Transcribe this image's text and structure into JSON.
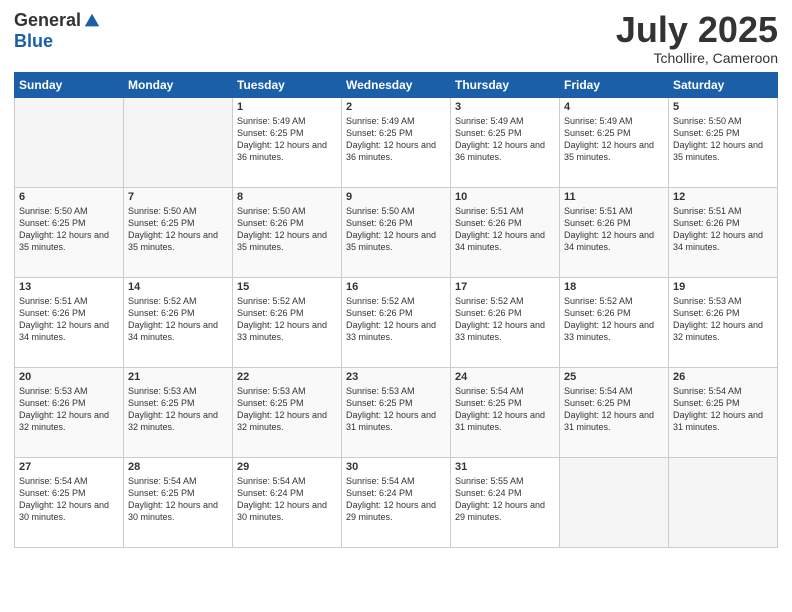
{
  "logo": {
    "general": "General",
    "blue": "Blue"
  },
  "title": {
    "month_year": "July 2025",
    "location": "Tchollire, Cameroon"
  },
  "weekdays": [
    "Sunday",
    "Monday",
    "Tuesday",
    "Wednesday",
    "Thursday",
    "Friday",
    "Saturday"
  ],
  "weeks": [
    [
      {
        "day": "",
        "sunrise": "",
        "sunset": "",
        "daylight": ""
      },
      {
        "day": "",
        "sunrise": "",
        "sunset": "",
        "daylight": ""
      },
      {
        "day": "1",
        "sunrise": "Sunrise: 5:49 AM",
        "sunset": "Sunset: 6:25 PM",
        "daylight": "Daylight: 12 hours and 36 minutes."
      },
      {
        "day": "2",
        "sunrise": "Sunrise: 5:49 AM",
        "sunset": "Sunset: 6:25 PM",
        "daylight": "Daylight: 12 hours and 36 minutes."
      },
      {
        "day": "3",
        "sunrise": "Sunrise: 5:49 AM",
        "sunset": "Sunset: 6:25 PM",
        "daylight": "Daylight: 12 hours and 36 minutes."
      },
      {
        "day": "4",
        "sunrise": "Sunrise: 5:49 AM",
        "sunset": "Sunset: 6:25 PM",
        "daylight": "Daylight: 12 hours and 35 minutes."
      },
      {
        "day": "5",
        "sunrise": "Sunrise: 5:50 AM",
        "sunset": "Sunset: 6:25 PM",
        "daylight": "Daylight: 12 hours and 35 minutes."
      }
    ],
    [
      {
        "day": "6",
        "sunrise": "Sunrise: 5:50 AM",
        "sunset": "Sunset: 6:25 PM",
        "daylight": "Daylight: 12 hours and 35 minutes."
      },
      {
        "day": "7",
        "sunrise": "Sunrise: 5:50 AM",
        "sunset": "Sunset: 6:25 PM",
        "daylight": "Daylight: 12 hours and 35 minutes."
      },
      {
        "day": "8",
        "sunrise": "Sunrise: 5:50 AM",
        "sunset": "Sunset: 6:26 PM",
        "daylight": "Daylight: 12 hours and 35 minutes."
      },
      {
        "day": "9",
        "sunrise": "Sunrise: 5:50 AM",
        "sunset": "Sunset: 6:26 PM",
        "daylight": "Daylight: 12 hours and 35 minutes."
      },
      {
        "day": "10",
        "sunrise": "Sunrise: 5:51 AM",
        "sunset": "Sunset: 6:26 PM",
        "daylight": "Daylight: 12 hours and 34 minutes."
      },
      {
        "day": "11",
        "sunrise": "Sunrise: 5:51 AM",
        "sunset": "Sunset: 6:26 PM",
        "daylight": "Daylight: 12 hours and 34 minutes."
      },
      {
        "day": "12",
        "sunrise": "Sunrise: 5:51 AM",
        "sunset": "Sunset: 6:26 PM",
        "daylight": "Daylight: 12 hours and 34 minutes."
      }
    ],
    [
      {
        "day": "13",
        "sunrise": "Sunrise: 5:51 AM",
        "sunset": "Sunset: 6:26 PM",
        "daylight": "Daylight: 12 hours and 34 minutes."
      },
      {
        "day": "14",
        "sunrise": "Sunrise: 5:52 AM",
        "sunset": "Sunset: 6:26 PM",
        "daylight": "Daylight: 12 hours and 34 minutes."
      },
      {
        "day": "15",
        "sunrise": "Sunrise: 5:52 AM",
        "sunset": "Sunset: 6:26 PM",
        "daylight": "Daylight: 12 hours and 33 minutes."
      },
      {
        "day": "16",
        "sunrise": "Sunrise: 5:52 AM",
        "sunset": "Sunset: 6:26 PM",
        "daylight": "Daylight: 12 hours and 33 minutes."
      },
      {
        "day": "17",
        "sunrise": "Sunrise: 5:52 AM",
        "sunset": "Sunset: 6:26 PM",
        "daylight": "Daylight: 12 hours and 33 minutes."
      },
      {
        "day": "18",
        "sunrise": "Sunrise: 5:52 AM",
        "sunset": "Sunset: 6:26 PM",
        "daylight": "Daylight: 12 hours and 33 minutes."
      },
      {
        "day": "19",
        "sunrise": "Sunrise: 5:53 AM",
        "sunset": "Sunset: 6:26 PM",
        "daylight": "Daylight: 12 hours and 32 minutes."
      }
    ],
    [
      {
        "day": "20",
        "sunrise": "Sunrise: 5:53 AM",
        "sunset": "Sunset: 6:26 PM",
        "daylight": "Daylight: 12 hours and 32 minutes."
      },
      {
        "day": "21",
        "sunrise": "Sunrise: 5:53 AM",
        "sunset": "Sunset: 6:25 PM",
        "daylight": "Daylight: 12 hours and 32 minutes."
      },
      {
        "day": "22",
        "sunrise": "Sunrise: 5:53 AM",
        "sunset": "Sunset: 6:25 PM",
        "daylight": "Daylight: 12 hours and 32 minutes."
      },
      {
        "day": "23",
        "sunrise": "Sunrise: 5:53 AM",
        "sunset": "Sunset: 6:25 PM",
        "daylight": "Daylight: 12 hours and 31 minutes."
      },
      {
        "day": "24",
        "sunrise": "Sunrise: 5:54 AM",
        "sunset": "Sunset: 6:25 PM",
        "daylight": "Daylight: 12 hours and 31 minutes."
      },
      {
        "day": "25",
        "sunrise": "Sunrise: 5:54 AM",
        "sunset": "Sunset: 6:25 PM",
        "daylight": "Daylight: 12 hours and 31 minutes."
      },
      {
        "day": "26",
        "sunrise": "Sunrise: 5:54 AM",
        "sunset": "Sunset: 6:25 PM",
        "daylight": "Daylight: 12 hours and 31 minutes."
      }
    ],
    [
      {
        "day": "27",
        "sunrise": "Sunrise: 5:54 AM",
        "sunset": "Sunset: 6:25 PM",
        "daylight": "Daylight: 12 hours and 30 minutes."
      },
      {
        "day": "28",
        "sunrise": "Sunrise: 5:54 AM",
        "sunset": "Sunset: 6:25 PM",
        "daylight": "Daylight: 12 hours and 30 minutes."
      },
      {
        "day": "29",
        "sunrise": "Sunrise: 5:54 AM",
        "sunset": "Sunset: 6:24 PM",
        "daylight": "Daylight: 12 hours and 30 minutes."
      },
      {
        "day": "30",
        "sunrise": "Sunrise: 5:54 AM",
        "sunset": "Sunset: 6:24 PM",
        "daylight": "Daylight: 12 hours and 29 minutes."
      },
      {
        "day": "31",
        "sunrise": "Sunrise: 5:55 AM",
        "sunset": "Sunset: 6:24 PM",
        "daylight": "Daylight: 12 hours and 29 minutes."
      },
      {
        "day": "",
        "sunrise": "",
        "sunset": "",
        "daylight": ""
      },
      {
        "day": "",
        "sunrise": "",
        "sunset": "",
        "daylight": ""
      }
    ]
  ]
}
